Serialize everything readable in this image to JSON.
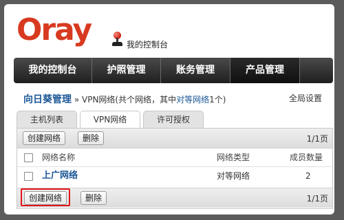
{
  "header": {
    "logo_text": "Oray",
    "caption": "我的控制台"
  },
  "nav": {
    "items": [
      {
        "label": "我的控制台",
        "active": false
      },
      {
        "label": "护照管理",
        "active": false
      },
      {
        "label": "账务管理",
        "active": false
      },
      {
        "label": "产品管理",
        "active": true
      }
    ]
  },
  "breadcrumb": {
    "home": "向日葵管理",
    "sep": "»",
    "text_before": "VPN网络(共个网络，其中",
    "link": "对等网络",
    "text_after": "1个)"
  },
  "global_settings": "全局设置",
  "tabs": [
    {
      "label": "主机列表",
      "active": false
    },
    {
      "label": "VPN网络",
      "active": true
    },
    {
      "label": "许可授权",
      "active": false
    }
  ],
  "toolbar": {
    "create_label": "创建网络",
    "delete_label": "删除",
    "pager": "1/1页"
  },
  "table": {
    "headers": [
      "网络名称",
      "网络类型",
      "成员数量"
    ],
    "rows": [
      {
        "name": "上广网络",
        "type": "对等网络",
        "members": "2"
      }
    ]
  },
  "colors": {
    "brand": "#d83a20",
    "link": "#1b5796",
    "highlight": "#e3141a"
  }
}
